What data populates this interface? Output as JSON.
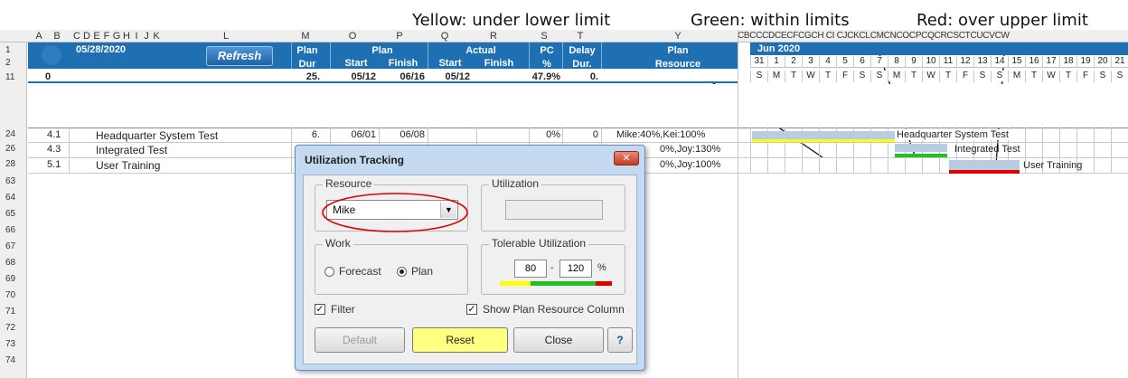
{
  "callouts": {
    "yellow": "Yellow: under lower limit",
    "green": "Green: within limits",
    "red": "Red: over upper limit"
  },
  "colors": {
    "header_blue": "#1f6fb3",
    "yellow": "#ffff00",
    "green": "#22c022",
    "red": "#e00000",
    "task_bar": "#b8cce4",
    "reset_button": "#ffff80"
  },
  "columns": [
    "A",
    "B",
    "C",
    "D",
    "E",
    "F",
    "G",
    "H",
    "I",
    "J",
    "K",
    "L",
    "M",
    "O",
    "P",
    "Q",
    "R",
    "S",
    "T",
    "Y"
  ],
  "gantt_column_letters": "CBCCCDCECFCGCH CI CJCKCLCMCNCOCPCQCRCSCTCUCVCW",
  "header": {
    "date": "05/28/2020",
    "refresh": "Refresh",
    "plan_dur_1": "Plan",
    "plan_dur_2": "Dur",
    "plan_label": "Plan",
    "plan_start": "Start",
    "plan_finish": "Finish",
    "actual_label": "Actual",
    "actual_start": "Start",
    "actual_finish": "Finish",
    "pc_1": "PC",
    "pc_2": "%",
    "delay_1": "Delay",
    "delay_2": "Dur.",
    "resource_1": "Plan",
    "resource_2": "Resource",
    "month": "Jun 2020"
  },
  "row_numbers": {
    "r1": "1",
    "r2": "2",
    "r11": "11",
    "r24": "24",
    "r26": "26",
    "r28": "28",
    "r63": "63",
    "r64": "64",
    "r65": "65",
    "r66": "66",
    "r67": "67",
    "r68": "68",
    "r69": "69",
    "r70": "70",
    "r71": "71",
    "r72": "72",
    "r73": "73",
    "r74": "74"
  },
  "summary_row": {
    "id": "0",
    "dur": "25.",
    "start": "05/12",
    "finish": "06/16",
    "actual_start": "05/12",
    "pc": "47.9%",
    "delay": "0."
  },
  "tasks": [
    {
      "id": "4.1",
      "name": "Headquarter System Test",
      "dur": "6.",
      "start": "06/01",
      "finish": "06/08",
      "pc": "0%",
      "delay": "0",
      "resource": "Mike:40%,Kei:100%"
    },
    {
      "id": "4.3",
      "name": "Integrated Test",
      "resource": "0%,Joy:130%"
    },
    {
      "id": "5.1",
      "name": "User Training",
      "resource": "0%,Joy:100%"
    }
  ],
  "gantt": {
    "day_numbers": [
      "31",
      "1",
      "2",
      "3",
      "4",
      "5",
      "6",
      "7",
      "8",
      "9",
      "10",
      "11",
      "12",
      "13",
      "14",
      "15",
      "16",
      "17",
      "18",
      "19",
      "20",
      "21"
    ],
    "weekdays": [
      "S",
      "M",
      "T",
      "W",
      "T",
      "F",
      "S",
      "S",
      "M",
      "T",
      "W",
      "T",
      "F",
      "S",
      "S",
      "M",
      "T",
      "W",
      "T",
      "F",
      "S",
      "S"
    ],
    "bar_labels": [
      "Headquarter System Test",
      "Integrated Test",
      "User Training"
    ]
  },
  "dialog": {
    "title": "Utilization Tracking",
    "resource_label": "Resource",
    "resource_value": "Mike",
    "utilization_label": "Utilization",
    "utilization_value": "",
    "work_label": "Work",
    "forecast": "Forecast",
    "plan": "Plan",
    "work_selected": "Plan",
    "tolerable_label": "Tolerable Utilization",
    "lower": "80",
    "dash": "-",
    "upper": "120",
    "pct": "%",
    "filter": "Filter",
    "filter_checked": true,
    "show_resource": "Show Plan Resource Column",
    "show_resource_checked": true,
    "btn_default": "Default",
    "btn_reset": "Reset",
    "btn_close": "Close",
    "btn_help": "?"
  }
}
